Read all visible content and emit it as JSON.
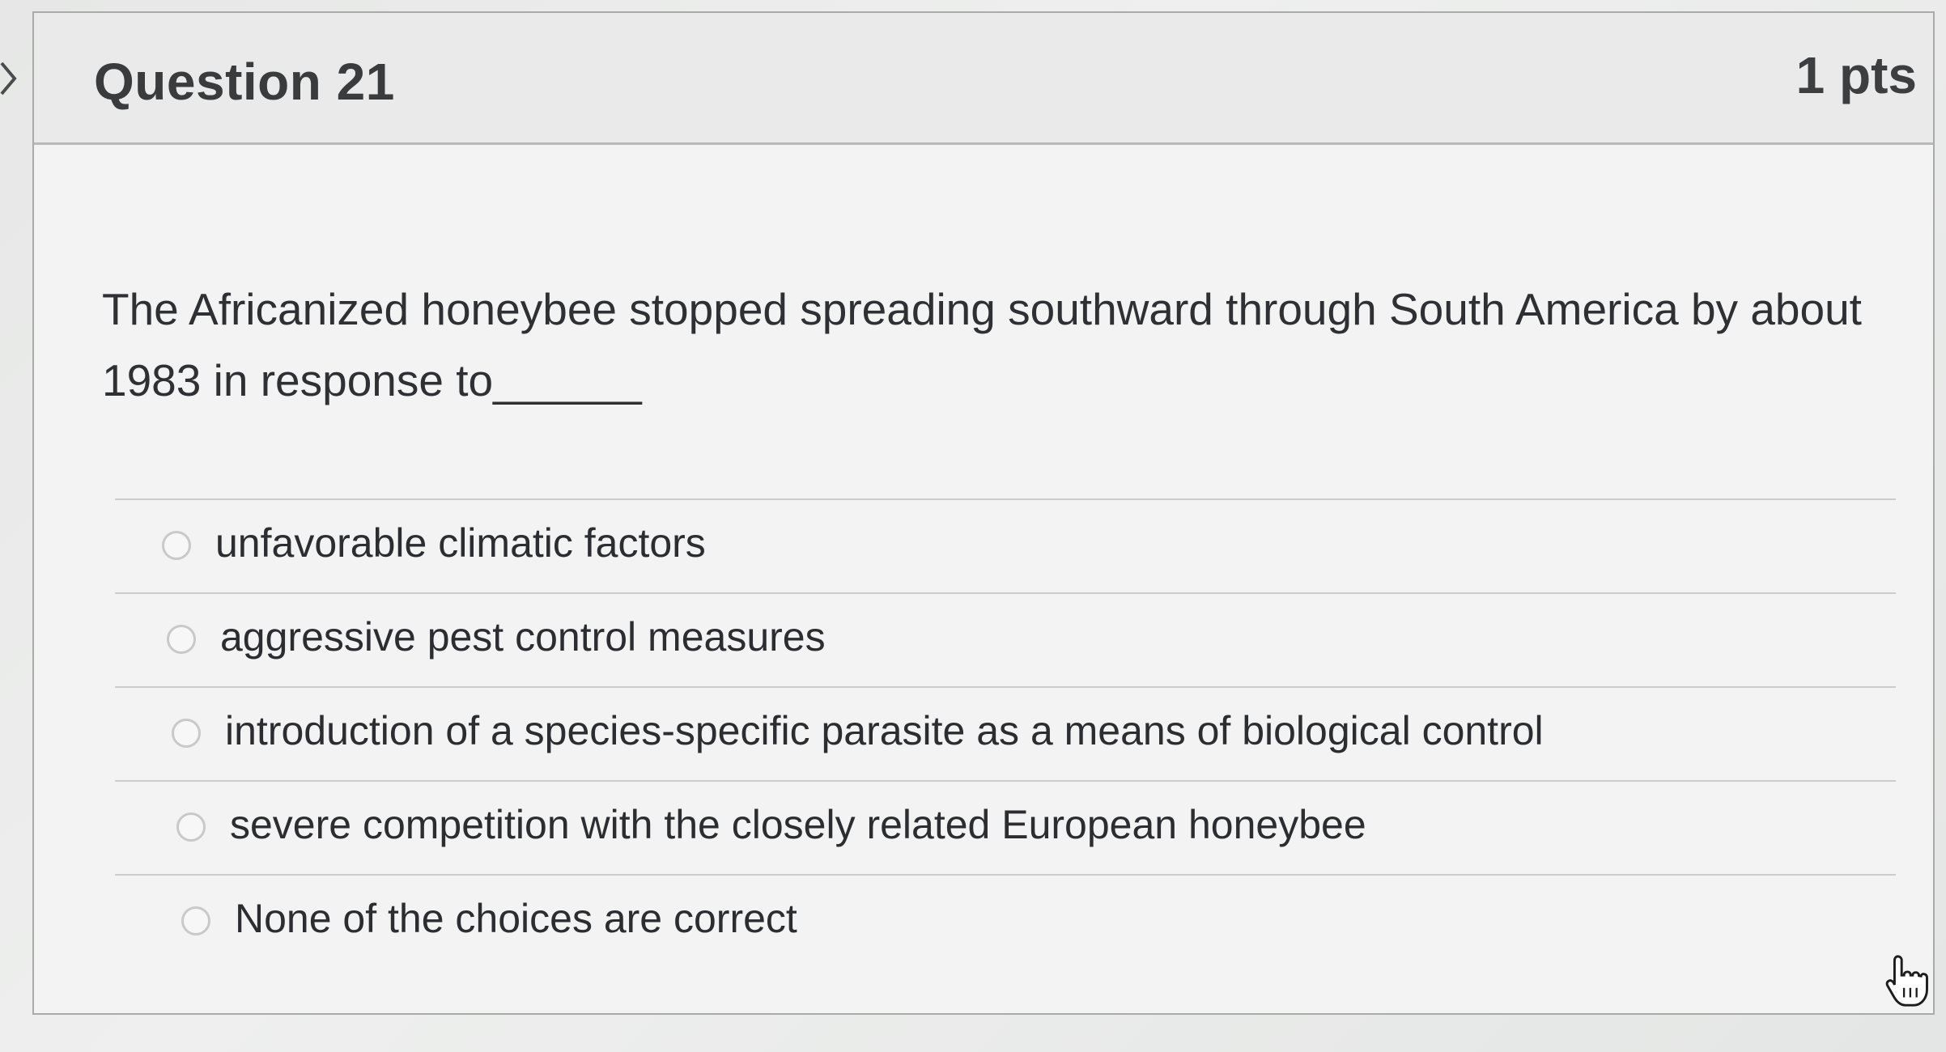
{
  "question": {
    "title": "Question 21",
    "points": "1 pts",
    "text": "The Africanized honeybee stopped spreading southward through South America by about 1983 in response to______"
  },
  "answers": [
    {
      "label": "unfavorable climatic factors",
      "selected": false
    },
    {
      "label": "aggressive pest control measures",
      "selected": false
    },
    {
      "label": "introduction of a species-specific parasite as a means of biological control",
      "selected": false
    },
    {
      "label": "severe competition with the closely related European honeybee",
      "selected": false
    },
    {
      "label": "None of the choices are correct",
      "selected": false
    }
  ],
  "icons": {
    "collapse": "chevron-right-icon",
    "cursor": "hand-pointer-icon"
  },
  "colors": {
    "text": "#2f3033",
    "header_bg": "#e9eae9",
    "border": "#a9aaa9"
  }
}
